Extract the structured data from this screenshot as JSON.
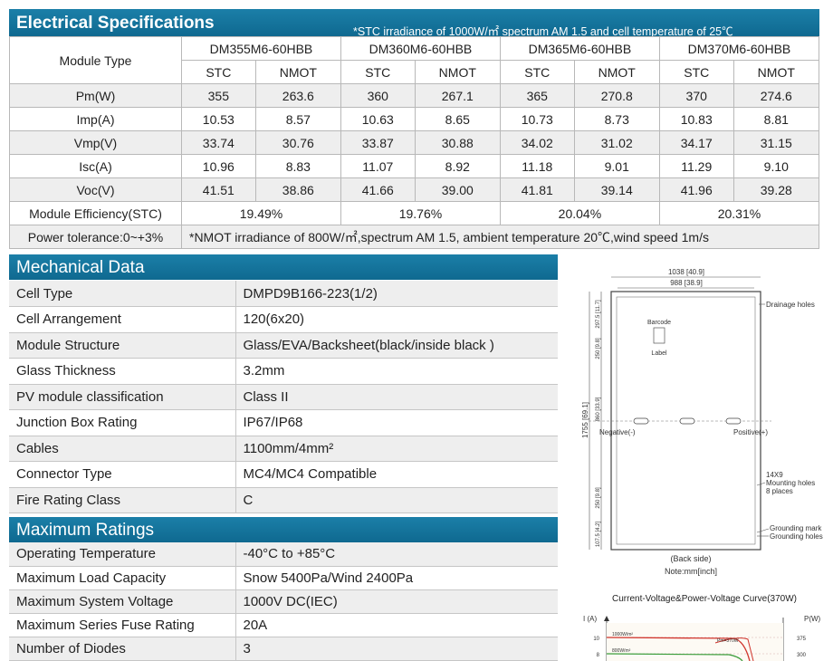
{
  "electrical": {
    "title": "Electrical Specifications",
    "stc_note": "*STC irradiance of 1000W/㎡ spectrum AM 1.5 and cell temperature of 25℃",
    "module_type_label": "Module Type",
    "models": [
      "DM355M6-60HBB",
      "DM360M6-60HBB",
      "DM365M6-60HBB",
      "DM370M6-60HBB"
    ],
    "sub_headers": [
      "STC",
      "NMOT",
      "STC",
      "NMOT",
      "STC",
      "NMOT",
      "STC",
      "NMOT"
    ],
    "rows": [
      {
        "label": "Pm(W)",
        "values": [
          "355",
          "263.6",
          "360",
          "267.1",
          "365",
          "270.8",
          "370",
          "274.6"
        ]
      },
      {
        "label": "Imp(A)",
        "values": [
          "10.53",
          "8.57",
          "10.63",
          "8.65",
          "10.73",
          "8.73",
          "10.83",
          "8.81"
        ]
      },
      {
        "label": "Vmp(V)",
        "values": [
          "33.74",
          "30.76",
          "33.87",
          "30.88",
          "34.02",
          "31.02",
          "34.17",
          "31.15"
        ]
      },
      {
        "label": "Isc(A)",
        "values": [
          "10.96",
          "8.83",
          "11.07",
          "8.92",
          "11.18",
          "9.01",
          "11.29",
          "9.10"
        ]
      },
      {
        "label": "Voc(V)",
        "values": [
          "41.51",
          "38.86",
          "41.66",
          "39.00",
          "41.81",
          "39.14",
          "41.96",
          "39.28"
        ]
      }
    ],
    "efficiency_label": "Module Efficiency(STC)",
    "efficiency": [
      "19.49%",
      "19.76%",
      "20.04%",
      "20.31%"
    ],
    "tolerance_label": "Power tolerance:0~+3%",
    "nmot_note": "*NMOT irradiance of 800W/㎡,spectrum AM 1.5, ambient temperature 20℃,wind speed 1m/s"
  },
  "mechanical": {
    "title": "Mechanical Data",
    "rows": [
      {
        "label": "Cell Type",
        "value": "DMPD9B166-223(1/2)"
      },
      {
        "label": "Cell Arrangement",
        "value": "120(6x20)"
      },
      {
        "label": "Module Structure",
        "value": "Glass/EVA/Backsheet(black/inside black )"
      },
      {
        "label": "Glass Thickness",
        "value": "3.2mm"
      },
      {
        "label": "PV module classification",
        "value": "Class II"
      },
      {
        "label": "Junction Box Rating",
        "value": "IP67/IP68"
      },
      {
        "label": "Cables",
        "value": "1100mm/4mm²"
      },
      {
        "label": "Connector Type",
        "value": "MC4/MC4 Compatible"
      },
      {
        "label": "Fire Rating Class",
        "value": "C"
      }
    ]
  },
  "maximum": {
    "title": "Maximum Ratings",
    "rows": [
      {
        "label": "Operating Temperature",
        "value": "-40°C to +85°C"
      },
      {
        "label": "Maximum Load Capacity",
        "value": "Snow 5400Pa/Wind 2400Pa"
      },
      {
        "label": "Maximum System Voltage",
        "value": "1000V DC(IEC)"
      },
      {
        "label": "Maximum Series Fuse Rating",
        "value": "20A"
      },
      {
        "label": "Number of Diodes",
        "value": "3"
      }
    ]
  },
  "drawing": {
    "width_outer": "1038 [40.9]",
    "width_inner": "988 [38.9]",
    "height_total": "1755 [69.1]",
    "dim_860": "860 [33.9]",
    "dim_top": "297.5 [11.7]",
    "dim_mid": "250 [9.8]",
    "dim_mid2": "250 [9.8]",
    "dim_bottom": "107.5 [4.2]",
    "drainage": "Drainage holes",
    "barcode": "Barcode",
    "label": "Label",
    "negative": "Negative(-)",
    "positive": "Positive(+)",
    "mounting": [
      "14X9",
      "Mounting holes",
      "8 places"
    ],
    "grounding": [
      "Grounding mark",
      "Grounding holes"
    ],
    "back_side": "(Back side)",
    "note": "Note:mm[inch]"
  },
  "curve": {
    "title": "Current-Voltage&Power-Voltage Curve(370W)",
    "y_left": "I (A)",
    "y_right": "P(W)",
    "ticks_left": [
      "10",
      "8"
    ],
    "ticks_right": [
      "375",
      "300"
    ],
    "labels": [
      "1000W/m²",
      "800W/m²",
      "Pm=370W"
    ],
    "colors": {
      "red": "#d0342c",
      "green": "#3a9d3a"
    }
  }
}
